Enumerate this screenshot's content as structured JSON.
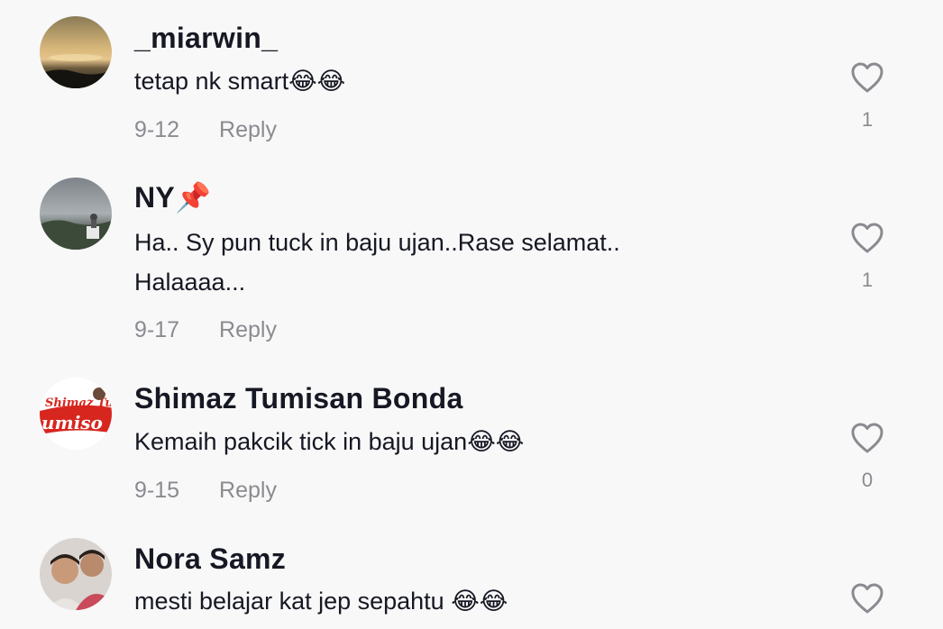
{
  "comments": [
    {
      "username": "_miarwin_",
      "text": "tetap nk smart😂😂",
      "date": "9-12",
      "reply": "Reply",
      "likes": "1"
    },
    {
      "username": "NY📌",
      "text": "Ha.. Sy pun tuck in baju ujan..Rase selamat.. Halaaaa...",
      "date": "9-17",
      "reply": "Reply",
      "likes": "1"
    },
    {
      "username": "Shimaz Tumisan Bonda",
      "text": "Kemaih pakcik tick in baju ujan😂😂",
      "date": "9-15",
      "reply": "Reply",
      "likes": "0",
      "avatar_text": "Shimaz Tumisan"
    },
    {
      "username": "Nora Samz",
      "text": "mesti belajar kat jep sepahtu 😂😂",
      "likes": ""
    }
  ],
  "icons": {
    "like": "heart-outline-icon"
  },
  "colors": {
    "background": "#f8f8f8",
    "primary_text": "#161823",
    "secondary_text": "#8a8b91"
  }
}
